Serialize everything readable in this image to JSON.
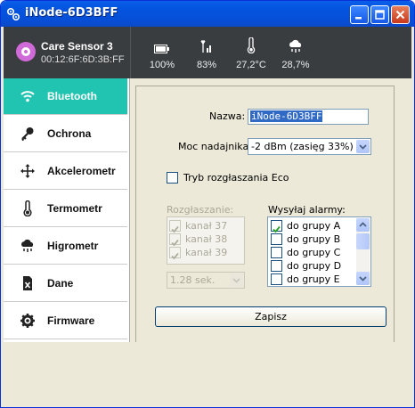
{
  "window": {
    "title": "iNode-6D3BFF"
  },
  "device": {
    "name": "Care Sensor 3",
    "mac": "00:12:6F:6D:3B:FF"
  },
  "stats": [
    {
      "icon": "battery-icon",
      "value": "100%"
    },
    {
      "icon": "signal-icon",
      "value": "83%"
    },
    {
      "icon": "thermometer-icon",
      "value": "27,2°C"
    },
    {
      "icon": "humidity-cloud-icon",
      "value": "28,7%"
    }
  ],
  "sidebar": {
    "items": [
      {
        "label": "Bluetooth",
        "icon": "wifi-icon",
        "active": true
      },
      {
        "label": "Ochrona",
        "icon": "key-icon"
      },
      {
        "label": "Akcelerometr",
        "icon": "move-arrows-icon"
      },
      {
        "label": "Termometr",
        "icon": "thermometer-icon"
      },
      {
        "label": "Higrometr",
        "icon": "rain-cloud-icon"
      },
      {
        "label": "Dane",
        "icon": "data-file-icon"
      },
      {
        "label": "Firmware",
        "icon": "gear-icon"
      }
    ]
  },
  "form": {
    "name_label": "Nazwa:",
    "name_value": "iNode-6D3BFF",
    "power_label": "Moc nadajnika:",
    "power_value": "-2 dBm  (zasięg 33%)",
    "eco_label": "Tryb rozgłaszania Eco",
    "eco_checked": false,
    "broadcast_label": "Rozgłaszanie:",
    "channels": [
      {
        "label": "kanał 37",
        "checked": true
      },
      {
        "label": "kanał 38",
        "checked": true
      },
      {
        "label": "kanał 39",
        "checked": true
      }
    ],
    "interval_value": "1.28 sek.",
    "alarms_label": "Wysyłaj alarmy:",
    "groups": [
      {
        "label": "do grupy A",
        "checked": true
      },
      {
        "label": "do grupy B",
        "checked": false
      },
      {
        "label": "do grupy C",
        "checked": false
      },
      {
        "label": "do grupy D",
        "checked": false
      },
      {
        "label": "do grupy E",
        "checked": false
      }
    ],
    "save_label": "Zapisz"
  }
}
